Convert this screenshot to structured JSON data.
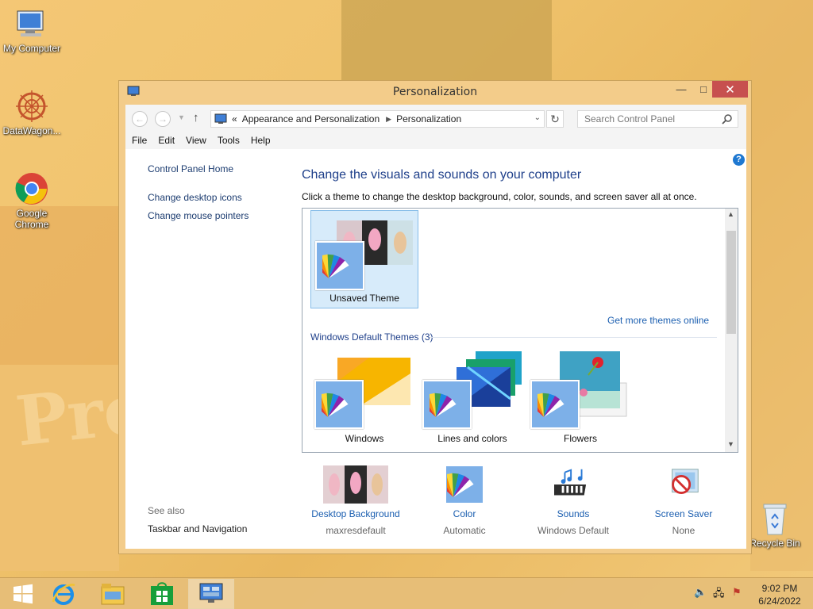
{
  "desktop": {
    "wallpaper_text": "Prep",
    "icons": [
      {
        "label": "My Computer"
      },
      {
        "label": "DataWagon..."
      },
      {
        "label": "Google Chrome"
      },
      {
        "label": "Recycle Bin"
      }
    ]
  },
  "window": {
    "title": "Personalization",
    "address": {
      "prefix": "«",
      "crumbs": [
        "Appearance and Personalization",
        "Personalization"
      ]
    },
    "search_placeholder": "Search Control Panel",
    "menu": [
      "File",
      "Edit",
      "View",
      "Tools",
      "Help"
    ],
    "left_links": [
      "Control Panel Home",
      "Change desktop icons",
      "Change mouse pointers"
    ],
    "see_also_label": "See also",
    "see_also_links": [
      "Taskbar and Navigation"
    ],
    "heading": "Change the visuals and sounds on your computer",
    "subheading": "Click a theme to change the desktop background, color, sounds, and screen saver all at once.",
    "my_themes": [
      {
        "label": "Unsaved Theme",
        "selected": true
      }
    ],
    "get_more_link": "Get more themes online",
    "default_group_title": "Windows Default Themes (3)",
    "default_themes": [
      {
        "label": "Windows"
      },
      {
        "label": "Lines and colors"
      },
      {
        "label": "Flowers"
      }
    ],
    "bottom": [
      {
        "label": "Desktop Background",
        "value": "maxresdefault"
      },
      {
        "label": "Color",
        "value": "Automatic"
      },
      {
        "label": "Sounds",
        "value": "Windows Default"
      },
      {
        "label": "Screen Saver",
        "value": "None"
      }
    ]
  },
  "taskbar": {
    "time": "9:02 PM",
    "date": "6/24/2022"
  },
  "colors": {
    "accent": "#f3cc8a",
    "link": "#1c5fb0",
    "heading": "#1e3f8a",
    "close": "#c7504f"
  }
}
